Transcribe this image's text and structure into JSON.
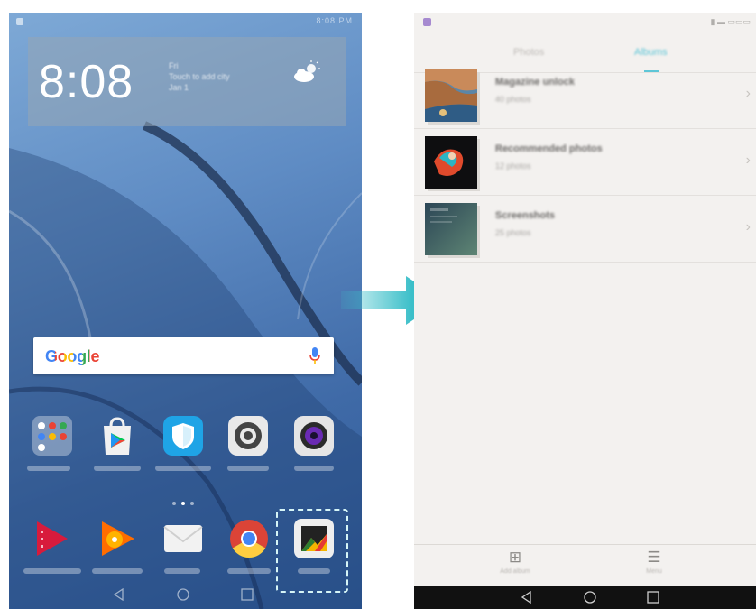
{
  "left_phone": {
    "status_bar": {
      "time": "8:08 PM"
    },
    "lock_widget": {
      "clock": "8:08",
      "weather_line1": "Fri",
      "weather_line2": "Touch to add city",
      "weather_line3": "Jan 1",
      "weather_icon": "partly-cloudy-icon"
    },
    "search_bar": {
      "logo": "Google",
      "mic_icon": "mic-icon"
    },
    "apps_row1": [
      {
        "name": "Google",
        "icon": "google-folder-icon"
      },
      {
        "name": "Play Store",
        "icon": "play-store-icon"
      },
      {
        "name": "Phone Manager",
        "icon": "phone-manager-icon"
      },
      {
        "name": "Settings",
        "icon": "settings-icon"
      },
      {
        "name": "Camera",
        "icon": "camera-icon"
      }
    ],
    "dock": [
      {
        "name": "Play Movies",
        "icon": "play-movies-icon"
      },
      {
        "name": "Play Music",
        "icon": "play-music-icon"
      },
      {
        "name": "Email",
        "icon": "email-icon"
      },
      {
        "name": "Chrome",
        "icon": "chrome-icon"
      },
      {
        "name": "Gallery",
        "icon": "gallery-icon"
      }
    ],
    "nav": [
      "back-icon",
      "home-icon",
      "recents-icon"
    ]
  },
  "right_phone": {
    "tabs": [
      {
        "label": "Photos",
        "active": false
      },
      {
        "label": "Albums",
        "active": true
      }
    ],
    "albums": [
      {
        "title": "Magazine unlock",
        "count": "40 photos"
      },
      {
        "title": "Recommended photos",
        "count": "12 photos"
      },
      {
        "title": "Screenshots",
        "count": "25 photos"
      }
    ],
    "toolbar": [
      {
        "label": "Add album",
        "icon": "add-album-icon"
      },
      {
        "label": "Menu",
        "icon": "menu-icon"
      }
    ],
    "nav": [
      "back-icon",
      "home-icon",
      "recents-icon"
    ]
  },
  "colors": {
    "accent": "#5ec6d7",
    "highlight_box": "#d6f5f7",
    "arrow": "#3bbfc9"
  }
}
